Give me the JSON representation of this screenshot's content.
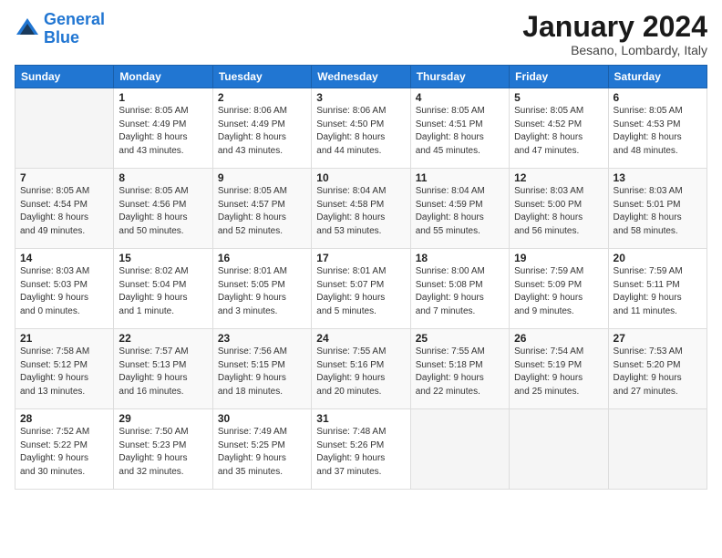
{
  "logo": {
    "line1": "General",
    "line2": "Blue"
  },
  "title": "January 2024",
  "subtitle": "Besano, Lombardy, Italy",
  "header_days": [
    "Sunday",
    "Monday",
    "Tuesday",
    "Wednesday",
    "Thursday",
    "Friday",
    "Saturday"
  ],
  "weeks": [
    [
      {
        "num": "",
        "info": ""
      },
      {
        "num": "1",
        "info": "Sunrise: 8:05 AM\nSunset: 4:49 PM\nDaylight: 8 hours\nand 43 minutes."
      },
      {
        "num": "2",
        "info": "Sunrise: 8:06 AM\nSunset: 4:49 PM\nDaylight: 8 hours\nand 43 minutes."
      },
      {
        "num": "3",
        "info": "Sunrise: 8:06 AM\nSunset: 4:50 PM\nDaylight: 8 hours\nand 44 minutes."
      },
      {
        "num": "4",
        "info": "Sunrise: 8:05 AM\nSunset: 4:51 PM\nDaylight: 8 hours\nand 45 minutes."
      },
      {
        "num": "5",
        "info": "Sunrise: 8:05 AM\nSunset: 4:52 PM\nDaylight: 8 hours\nand 47 minutes."
      },
      {
        "num": "6",
        "info": "Sunrise: 8:05 AM\nSunset: 4:53 PM\nDaylight: 8 hours\nand 48 minutes."
      }
    ],
    [
      {
        "num": "7",
        "info": "Sunrise: 8:05 AM\nSunset: 4:54 PM\nDaylight: 8 hours\nand 49 minutes."
      },
      {
        "num": "8",
        "info": "Sunrise: 8:05 AM\nSunset: 4:56 PM\nDaylight: 8 hours\nand 50 minutes."
      },
      {
        "num": "9",
        "info": "Sunrise: 8:05 AM\nSunset: 4:57 PM\nDaylight: 8 hours\nand 52 minutes."
      },
      {
        "num": "10",
        "info": "Sunrise: 8:04 AM\nSunset: 4:58 PM\nDaylight: 8 hours\nand 53 minutes."
      },
      {
        "num": "11",
        "info": "Sunrise: 8:04 AM\nSunset: 4:59 PM\nDaylight: 8 hours\nand 55 minutes."
      },
      {
        "num": "12",
        "info": "Sunrise: 8:03 AM\nSunset: 5:00 PM\nDaylight: 8 hours\nand 56 minutes."
      },
      {
        "num": "13",
        "info": "Sunrise: 8:03 AM\nSunset: 5:01 PM\nDaylight: 8 hours\nand 58 minutes."
      }
    ],
    [
      {
        "num": "14",
        "info": "Sunrise: 8:03 AM\nSunset: 5:03 PM\nDaylight: 9 hours\nand 0 minutes."
      },
      {
        "num": "15",
        "info": "Sunrise: 8:02 AM\nSunset: 5:04 PM\nDaylight: 9 hours\nand 1 minute."
      },
      {
        "num": "16",
        "info": "Sunrise: 8:01 AM\nSunset: 5:05 PM\nDaylight: 9 hours\nand 3 minutes."
      },
      {
        "num": "17",
        "info": "Sunrise: 8:01 AM\nSunset: 5:07 PM\nDaylight: 9 hours\nand 5 minutes."
      },
      {
        "num": "18",
        "info": "Sunrise: 8:00 AM\nSunset: 5:08 PM\nDaylight: 9 hours\nand 7 minutes."
      },
      {
        "num": "19",
        "info": "Sunrise: 7:59 AM\nSunset: 5:09 PM\nDaylight: 9 hours\nand 9 minutes."
      },
      {
        "num": "20",
        "info": "Sunrise: 7:59 AM\nSunset: 5:11 PM\nDaylight: 9 hours\nand 11 minutes."
      }
    ],
    [
      {
        "num": "21",
        "info": "Sunrise: 7:58 AM\nSunset: 5:12 PM\nDaylight: 9 hours\nand 13 minutes."
      },
      {
        "num": "22",
        "info": "Sunrise: 7:57 AM\nSunset: 5:13 PM\nDaylight: 9 hours\nand 16 minutes."
      },
      {
        "num": "23",
        "info": "Sunrise: 7:56 AM\nSunset: 5:15 PM\nDaylight: 9 hours\nand 18 minutes."
      },
      {
        "num": "24",
        "info": "Sunrise: 7:55 AM\nSunset: 5:16 PM\nDaylight: 9 hours\nand 20 minutes."
      },
      {
        "num": "25",
        "info": "Sunrise: 7:55 AM\nSunset: 5:18 PM\nDaylight: 9 hours\nand 22 minutes."
      },
      {
        "num": "26",
        "info": "Sunrise: 7:54 AM\nSunset: 5:19 PM\nDaylight: 9 hours\nand 25 minutes."
      },
      {
        "num": "27",
        "info": "Sunrise: 7:53 AM\nSunset: 5:20 PM\nDaylight: 9 hours\nand 27 minutes."
      }
    ],
    [
      {
        "num": "28",
        "info": "Sunrise: 7:52 AM\nSunset: 5:22 PM\nDaylight: 9 hours\nand 30 minutes."
      },
      {
        "num": "29",
        "info": "Sunrise: 7:50 AM\nSunset: 5:23 PM\nDaylight: 9 hours\nand 32 minutes."
      },
      {
        "num": "30",
        "info": "Sunrise: 7:49 AM\nSunset: 5:25 PM\nDaylight: 9 hours\nand 35 minutes."
      },
      {
        "num": "31",
        "info": "Sunrise: 7:48 AM\nSunset: 5:26 PM\nDaylight: 9 hours\nand 37 minutes."
      },
      {
        "num": "",
        "info": ""
      },
      {
        "num": "",
        "info": ""
      },
      {
        "num": "",
        "info": ""
      }
    ]
  ]
}
